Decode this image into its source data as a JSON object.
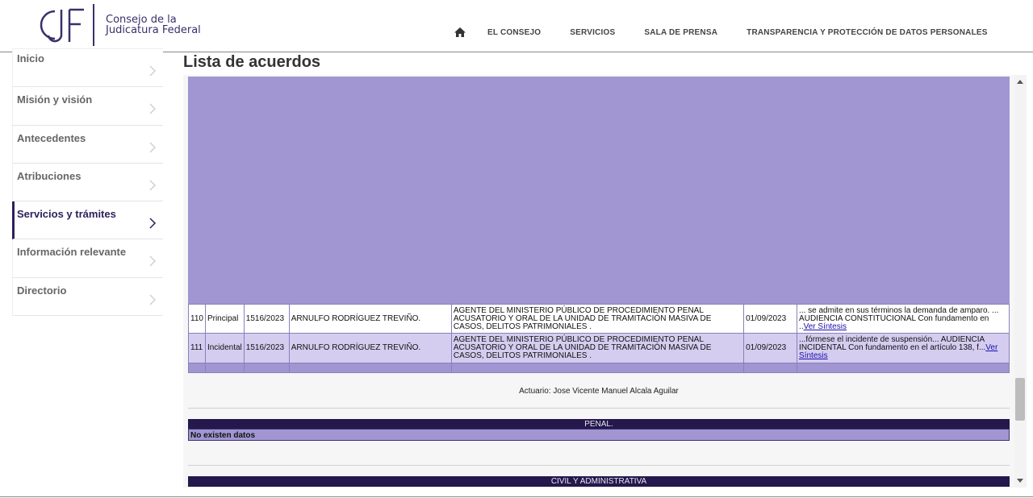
{
  "header": {
    "logo_letters": "CJF",
    "logo_line1": "Consejo de la",
    "logo_line2": "Judicatura Federal",
    "nav": [
      {
        "label": "EL CONSEJO"
      },
      {
        "label": "SERVICIOS"
      },
      {
        "label": "SALA DE PRENSA"
      },
      {
        "label": "TRANSPARENCIA Y PROTECCIÓN DE DATOS PERSONALES"
      }
    ],
    "home_icon": "home-icon"
  },
  "sidebar": {
    "items": [
      {
        "label": "Inicio"
      },
      {
        "label": "Misión y visión"
      },
      {
        "label": "Antecedentes"
      },
      {
        "label": "Atribuciones"
      },
      {
        "label": "Servicios y trámites"
      },
      {
        "label": "Información relevante"
      },
      {
        "label": "Directorio"
      }
    ],
    "active_index": 4
  },
  "page": {
    "title": "Lista de acuerdos"
  },
  "table": {
    "rows": [
      {
        "num": "110",
        "type": "Principal",
        "expediente": "1516/2023",
        "quejoso": "ARNULFO RODRÍGUEZ TREVIÑO.",
        "autoridad": "AGENTE DEL MINISTERIO PÚBLICO DE PROCEDIMIENTO PENAL ACUSATORIO Y ORAL DE LA UNIDAD DE TRAMITACIÓN MASIVA DE CASOS, DELITOS PATRIMONIALES .",
        "fecha": "01/09/2023",
        "sintesis": "... se admite en sus términos la demanda de amparo. ... AUDIENCIA CONSTITUCIONAL Con fundamento en ..",
        "link": "Ver Síntesis"
      },
      {
        "num": "111",
        "type": "Incidental",
        "expediente": "1516/2023",
        "quejoso": "ARNULFO RODRÍGUEZ TREVIÑO.",
        "autoridad": "AGENTE DEL MINISTERIO PÚBLICO DE PROCEDIMIENTO PENAL ACUSATORIO Y ORAL DE LA UNIDAD DE TRAMITACIÓN MASIVA DE CASOS, DELITOS PATRIMONIALES .",
        "fecha": "01/09/2023",
        "sintesis": "...fórmese el incidente de suspensión... AUDIENCIA INCIDENTAL Con fundamento en el artículo 138, f...",
        "link": "Ver Síntesis"
      }
    ]
  },
  "actuario": "Actuario: Jose Vicente Manuel Alcala Aguilar",
  "sections": [
    {
      "title": "PENAL.",
      "empty_text": "No existen datos"
    },
    {
      "title": "CIVIL Y ADMINISTRATIVA"
    }
  ],
  "colors": {
    "brand": "#2d1f5a",
    "lavender": "#a196d1",
    "section_bar": "#24184d"
  }
}
